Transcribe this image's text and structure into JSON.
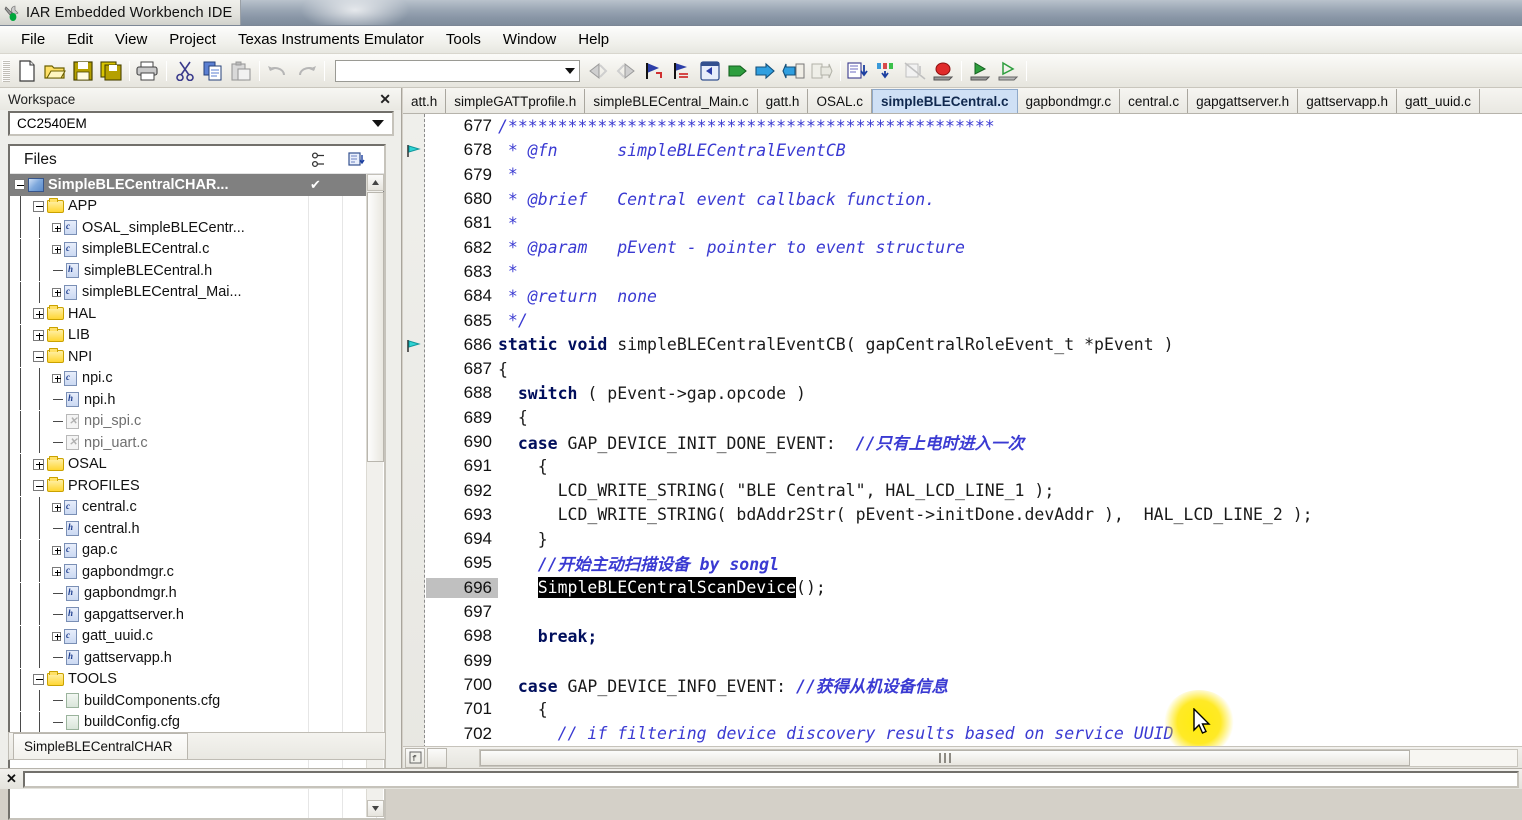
{
  "window": {
    "title": "IAR Embedded Workbench IDE",
    "app_icon": "iar-wrench-icon"
  },
  "menubar": {
    "items": [
      {
        "label": "File"
      },
      {
        "label": "Edit"
      },
      {
        "label": "View"
      },
      {
        "label": "Project"
      },
      {
        "label": "Texas Instruments Emulator"
      },
      {
        "label": "Tools"
      },
      {
        "label": "Window"
      },
      {
        "label": "Help"
      }
    ]
  },
  "toolbar": {
    "combo_value": "",
    "buttons": [
      {
        "name": "new-document-icon"
      },
      {
        "name": "open-folder-icon"
      },
      {
        "name": "save-icon"
      },
      {
        "name": "save-all-icon"
      },
      {
        "name": "print-icon"
      },
      {
        "name": "cut-icon"
      },
      {
        "name": "copy-icon"
      },
      {
        "name": "paste-icon"
      },
      {
        "name": "undo-icon"
      },
      {
        "name": "redo-icon"
      },
      {
        "name": "find-previous-icon"
      },
      {
        "name": "find-next-icon"
      },
      {
        "name": "goto-bookmark-icon"
      },
      {
        "name": "toggle-bookmark-icon"
      },
      {
        "name": "navigate-backward-icon"
      },
      {
        "name": "compile-icon"
      },
      {
        "name": "make-icon"
      },
      {
        "name": "debug-without-download-icon"
      },
      {
        "name": "build-all-icon"
      },
      {
        "name": "step-over-icon"
      },
      {
        "name": "step-into-icon"
      },
      {
        "name": "step-out-icon"
      },
      {
        "name": "stop-debug-icon"
      },
      {
        "name": "run-icon"
      },
      {
        "name": "download-and-debug-icon"
      }
    ]
  },
  "workspace": {
    "panel_title": "Workspace",
    "close_label": "✕",
    "config_selected": "CC2540EM",
    "files_column_header": "Files",
    "bottom_tab": "SimpleBLECentralCHAR",
    "tree": [
      {
        "label": "SimpleBLECentralCHAR...",
        "type": "project",
        "depth": 0,
        "toggle": "minus",
        "selected": true,
        "check": "✔"
      },
      {
        "label": "APP",
        "type": "folder",
        "depth": 1,
        "toggle": "minus"
      },
      {
        "label": "OSAL_simpleBLECentr...",
        "type": "c",
        "depth": 2,
        "toggle": "plus"
      },
      {
        "label": "simpleBLECentral.c",
        "type": "c",
        "depth": 2,
        "toggle": "plus"
      },
      {
        "label": "simpleBLECentral.h",
        "type": "h",
        "depth": 2,
        "toggle": "none"
      },
      {
        "label": "simpleBLECentral_Mai...",
        "type": "c",
        "depth": 2,
        "toggle": "plus"
      },
      {
        "label": "HAL",
        "type": "folder",
        "depth": 1,
        "toggle": "plus"
      },
      {
        "label": "LIB",
        "type": "folder",
        "depth": 1,
        "toggle": "plus"
      },
      {
        "label": "NPI",
        "type": "folder",
        "depth": 1,
        "toggle": "minus"
      },
      {
        "label": "npi.c",
        "type": "c",
        "depth": 2,
        "toggle": "plus"
      },
      {
        "label": "npi.h",
        "type": "h",
        "depth": 2,
        "toggle": "none"
      },
      {
        "label": "npi_spi.c",
        "type": "x",
        "depth": 2,
        "toggle": "none"
      },
      {
        "label": "npi_uart.c",
        "type": "x",
        "depth": 2,
        "toggle": "none"
      },
      {
        "label": "OSAL",
        "type": "folder",
        "depth": 1,
        "toggle": "plus"
      },
      {
        "label": "PROFILES",
        "type": "folder",
        "depth": 1,
        "toggle": "minus"
      },
      {
        "label": "central.c",
        "type": "c",
        "depth": 2,
        "toggle": "plus"
      },
      {
        "label": "central.h",
        "type": "h",
        "depth": 2,
        "toggle": "none"
      },
      {
        "label": "gap.c",
        "type": "c",
        "depth": 2,
        "toggle": "plus"
      },
      {
        "label": "gapbondmgr.c",
        "type": "c",
        "depth": 2,
        "toggle": "plus"
      },
      {
        "label": "gapbondmgr.h",
        "type": "h",
        "depth": 2,
        "toggle": "none"
      },
      {
        "label": "gapgattserver.h",
        "type": "h",
        "depth": 2,
        "toggle": "none"
      },
      {
        "label": "gatt_uuid.c",
        "type": "c",
        "depth": 2,
        "toggle": "plus"
      },
      {
        "label": "gattservapp.h",
        "type": "h",
        "depth": 2,
        "toggle": "none"
      },
      {
        "label": "TOOLS",
        "type": "folder",
        "depth": 1,
        "toggle": "minus"
      },
      {
        "label": "buildComponents.cfg",
        "type": "cfg",
        "depth": 2,
        "toggle": "none"
      },
      {
        "label": "buildConfig.cfg",
        "type": "cfg",
        "depth": 2,
        "toggle": "none"
      }
    ]
  },
  "editor": {
    "tabs": [
      {
        "label": "att.h",
        "active": false
      },
      {
        "label": "simpleGATTprofile.h",
        "active": false
      },
      {
        "label": "simpleBLECentral_Main.c",
        "active": false
      },
      {
        "label": "gatt.h",
        "active": false
      },
      {
        "label": "OSAL.c",
        "active": false
      },
      {
        "label": "simpleBLECentral.c",
        "active": true
      },
      {
        "label": "gapbondmgr.c",
        "active": false
      },
      {
        "label": "central.c",
        "active": false
      },
      {
        "label": "gapgattserver.h",
        "active": false
      },
      {
        "label": "gattservapp.h",
        "active": false
      },
      {
        "label": "gatt_uuid.c",
        "active": false
      }
    ],
    "current_line": 696,
    "selection_text": "SimpleBLECentralScanDevice",
    "lines": [
      {
        "n": 677,
        "segs": [
          {
            "t": "/*************************************************",
            "c": "cm"
          }
        ]
      },
      {
        "n": 678,
        "bookmark": true,
        "segs": [
          {
            "t": " * @fn      simpleBLECentralEventCB",
            "c": "cm"
          }
        ]
      },
      {
        "n": 679,
        "segs": [
          {
            "t": " *",
            "c": "cm"
          }
        ]
      },
      {
        "n": 680,
        "segs": [
          {
            "t": " * @brief   Central event callback function.",
            "c": "cm"
          }
        ]
      },
      {
        "n": 681,
        "segs": [
          {
            "t": " *",
            "c": "cm"
          }
        ]
      },
      {
        "n": 682,
        "segs": [
          {
            "t": " * @param   pEvent - pointer to event structure",
            "c": "cm"
          }
        ]
      },
      {
        "n": 683,
        "segs": [
          {
            "t": " *",
            "c": "cm"
          }
        ]
      },
      {
        "n": 684,
        "segs": [
          {
            "t": " * @return  none",
            "c": "cm"
          }
        ]
      },
      {
        "n": 685,
        "segs": [
          {
            "t": " */",
            "c": "cm"
          }
        ]
      },
      {
        "n": 686,
        "bookmark": true,
        "segs": [
          {
            "t": "static void",
            "c": "kw"
          },
          {
            "t": " simpleBLECentralEventCB( gapCentralRoleEvent_t *pEvent )",
            "c": ""
          }
        ]
      },
      {
        "n": 687,
        "segs": [
          {
            "t": "{",
            "c": ""
          }
        ]
      },
      {
        "n": 688,
        "segs": [
          {
            "t": "  ",
            "c": ""
          },
          {
            "t": "switch",
            "c": "kw"
          },
          {
            "t": " ( pEvent->gap.opcode )",
            "c": ""
          }
        ]
      },
      {
        "n": 689,
        "segs": [
          {
            "t": "  {",
            "c": ""
          }
        ]
      },
      {
        "n": 690,
        "segs": [
          {
            "t": "  ",
            "c": ""
          },
          {
            "t": "case",
            "c": "kw"
          },
          {
            "t": " GAP_DEVICE_INIT_DONE_EVENT:  ",
            "c": ""
          },
          {
            "t": "//只有上电时进入一次",
            "c": "cmcn"
          }
        ]
      },
      {
        "n": 691,
        "segs": [
          {
            "t": "    {",
            "c": ""
          }
        ]
      },
      {
        "n": 692,
        "segs": [
          {
            "t": "      LCD_WRITE_STRING( \"BLE Central\", HAL_LCD_LINE_1 );",
            "c": ""
          }
        ]
      },
      {
        "n": 693,
        "segs": [
          {
            "t": "      LCD_WRITE_STRING( bdAddr2Str( pEvent->initDone.devAddr ),  HAL_LCD_LINE_2 );",
            "c": ""
          }
        ]
      },
      {
        "n": 694,
        "segs": [
          {
            "t": "    }",
            "c": ""
          }
        ]
      },
      {
        "n": 695,
        "segs": [
          {
            "t": "    ",
            "c": ""
          },
          {
            "t": "//开始主动扫描设备 by songl",
            "c": "cmcn"
          }
        ]
      },
      {
        "n": 696,
        "current": true,
        "segs": [
          {
            "t": "    ",
            "c": ""
          },
          {
            "t": "SimpleBLECentralScanDevice",
            "c": "selx"
          },
          {
            "t": "();",
            "c": ""
          }
        ]
      },
      {
        "n": 697,
        "segs": [
          {
            "t": "",
            "c": ""
          }
        ]
      },
      {
        "n": 698,
        "segs": [
          {
            "t": "    ",
            "c": ""
          },
          {
            "t": "break;",
            "c": "kw"
          }
        ]
      },
      {
        "n": 699,
        "segs": [
          {
            "t": "",
            "c": ""
          }
        ]
      },
      {
        "n": 700,
        "segs": [
          {
            "t": "  ",
            "c": ""
          },
          {
            "t": "case",
            "c": "kw"
          },
          {
            "t": " GAP_DEVICE_INFO_EVENT: ",
            "c": ""
          },
          {
            "t": "//获得从机设备信息",
            "c": "cmcn"
          }
        ]
      },
      {
        "n": 701,
        "segs": [
          {
            "t": "    {",
            "c": ""
          }
        ]
      },
      {
        "n": 702,
        "segs": [
          {
            "t": "      ",
            "c": ""
          },
          {
            "t": "// if filtering device discovery results based on service UUID",
            "c": "cm"
          }
        ]
      }
    ]
  },
  "colors": {
    "keyword": "#000e5c",
    "comment": "#3a3ad2",
    "selection_bg": "#000000",
    "active_tab_bg": "#cfe0f5",
    "current_line_gutter": "#c0c0c0",
    "cursor_highlight": "#ffe600",
    "tree_selected_bg": "#808080"
  }
}
